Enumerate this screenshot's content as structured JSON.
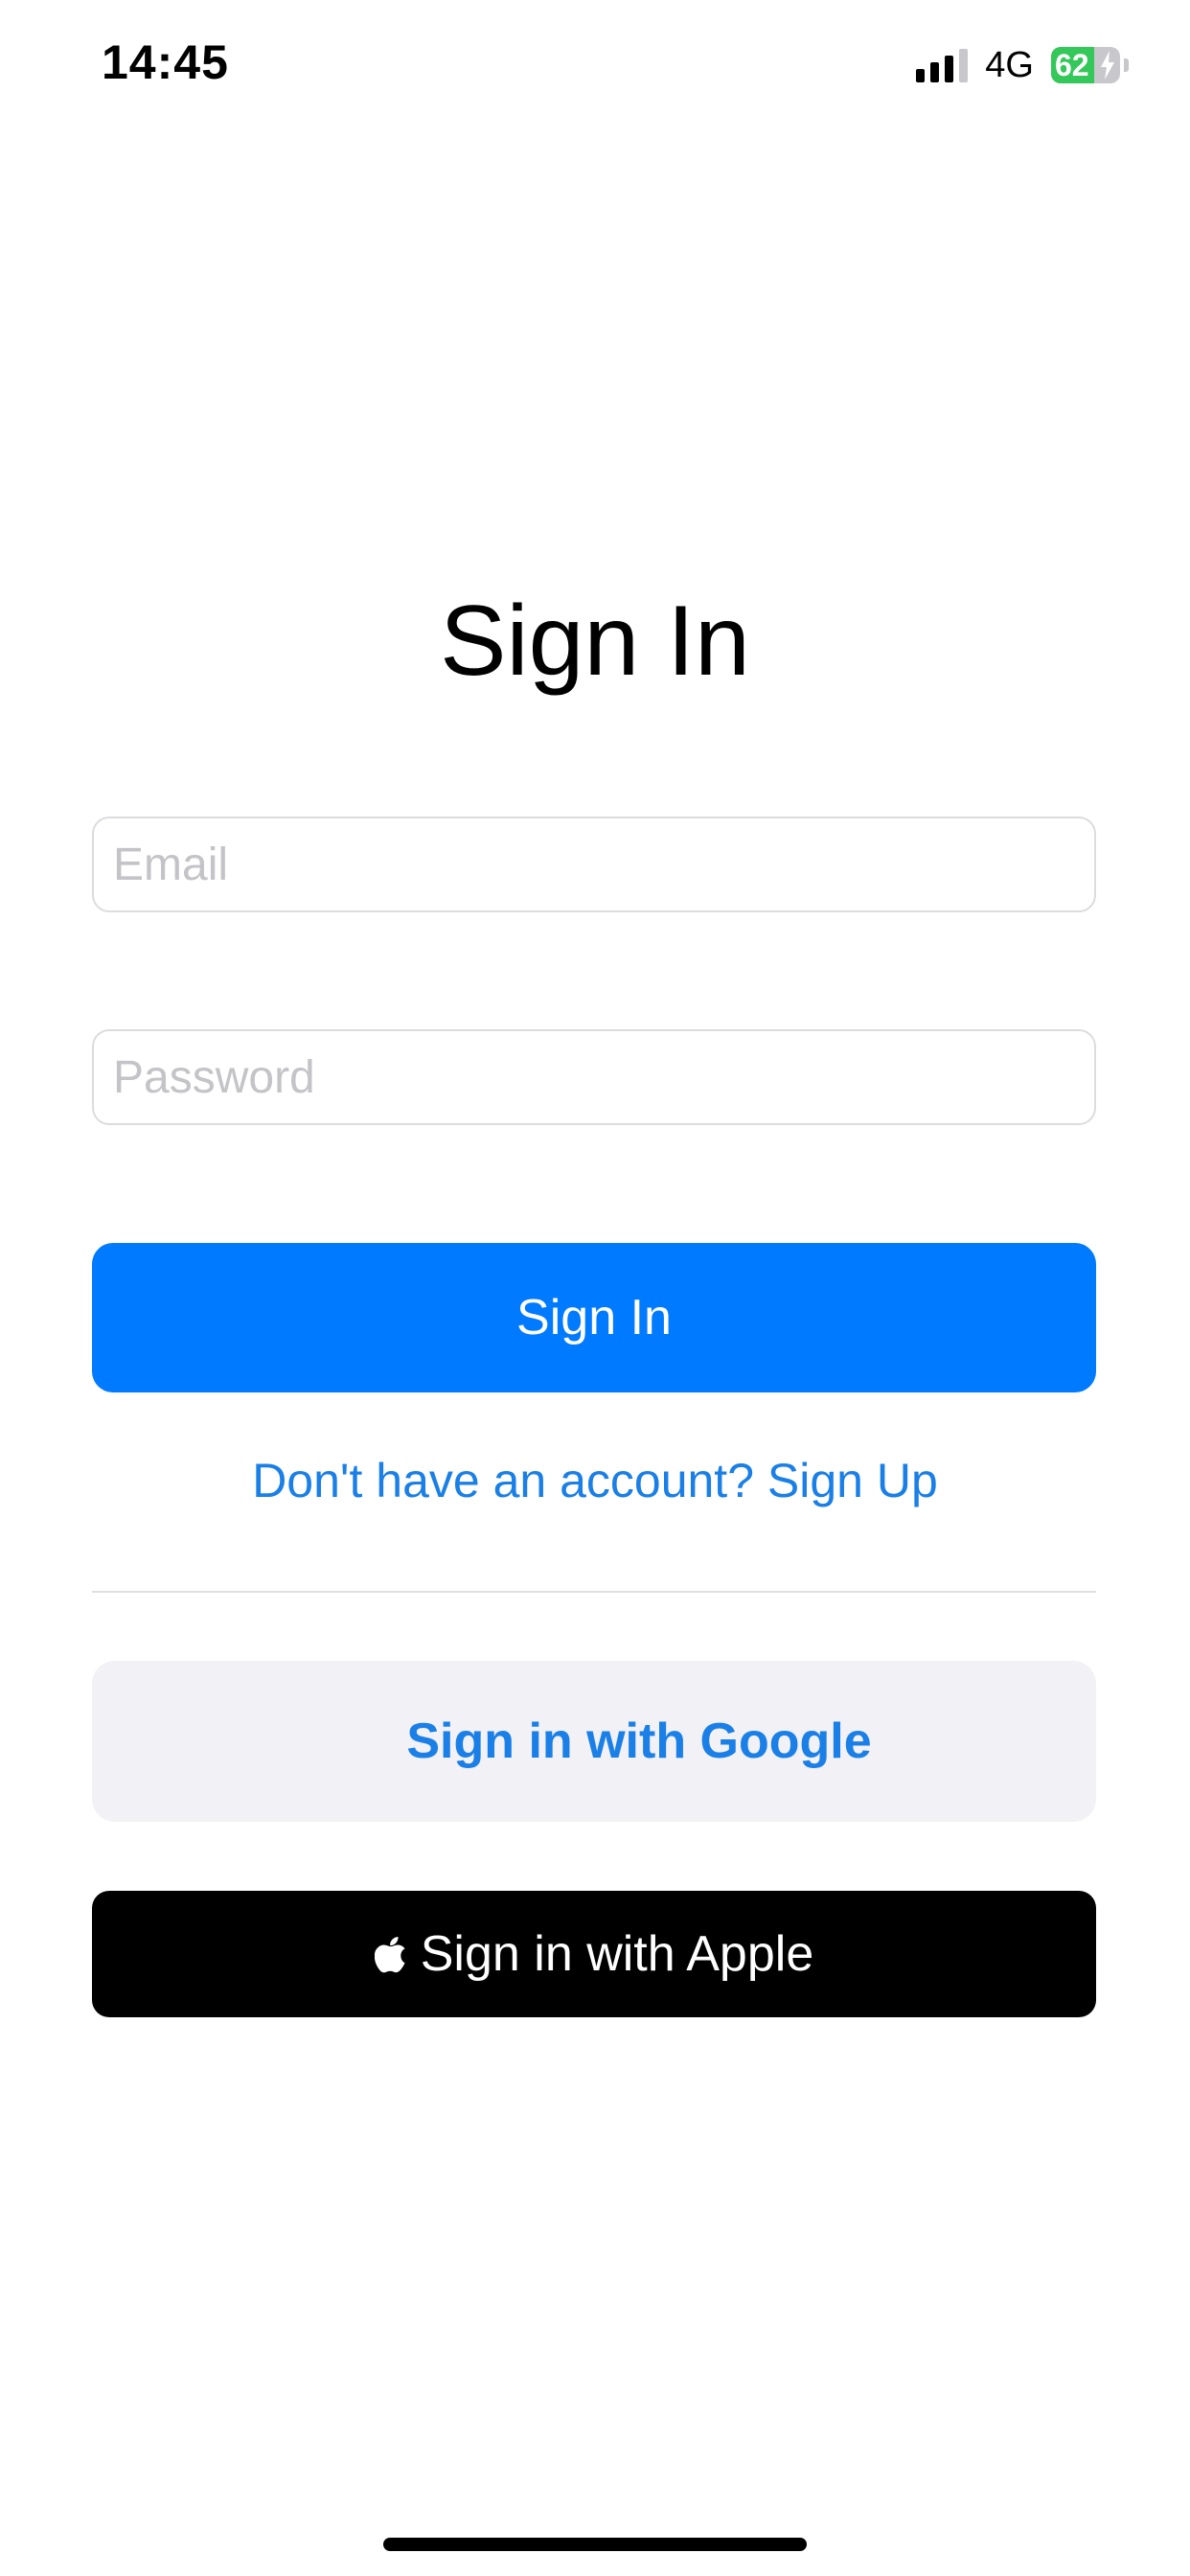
{
  "status_bar": {
    "time": "14:45",
    "network": "4G",
    "battery_percent": "62",
    "battery_level": 0.62,
    "battery_color": "#34c759",
    "charging": true
  },
  "page": {
    "title": "Sign In"
  },
  "form": {
    "email_placeholder": "Email",
    "email_value": "",
    "password_placeholder": "Password",
    "password_value": "",
    "sign_in_label": "Sign In",
    "sign_up_prompt": "Don't have an account? Sign Up"
  },
  "social": {
    "google_label": "Sign in with Google",
    "apple_label": "Sign in with Apple",
    "apple_icon": "apple-logo-icon"
  },
  "colors": {
    "accent": "#007aff",
    "link": "#1a7fe6",
    "google_bg": "#f1f1f6",
    "apple_bg": "#000000"
  }
}
